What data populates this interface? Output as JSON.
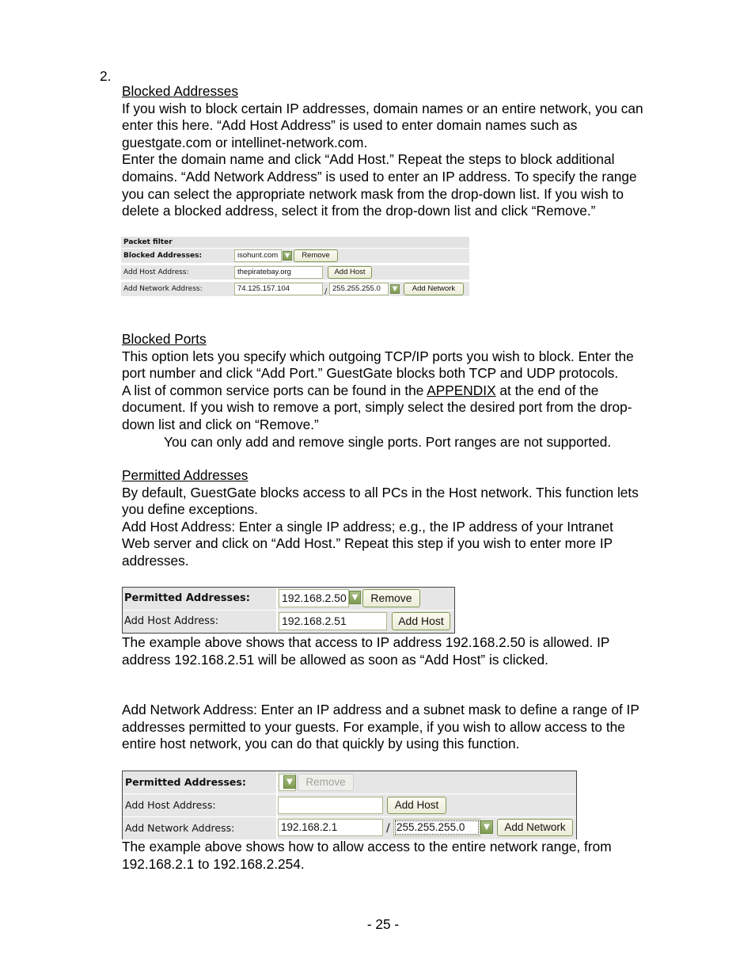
{
  "list_number": "2.",
  "sections": {
    "blocked_addresses": {
      "heading": "Blocked Addresses",
      "lines": [
        "If you wish to block certain IP addresses, domain names or an entire network, you can",
        "enter this here. “Add Host Address” is used to enter domain names such as",
        "guestgate.com or intellinet-network.com.",
        "Enter the domain name and click “Add Host.” Repeat the steps to block additional",
        "domains. “Add Network Address” is used to enter an IP address. To specify the range",
        "you can select the appropriate network mask from the drop-down list. If you wish to",
        "delete a blocked address, select it from the drop-down list and click “Remove.”"
      ]
    },
    "blocked_ports": {
      "heading": "Blocked Ports",
      "lines": [
        "This option lets you specify which outgoing TCP/IP ports you wish to block. Enter the",
        "port number and click “Add Port.” GuestGate blocks both TCP and UDP protocols."
      ],
      "appendix_prefix": "A list of common service ports can be found in the ",
      "appendix_link": "APPENDIX",
      "appendix_suffix": " at the end of the",
      "lines2": [
        "document. If you wish to remove a port, simply select the desired port from the drop-",
        "down list and click on “Remove.”"
      ],
      "note": "You can only add and remove single ports. Port ranges are not supported."
    },
    "permitted_addresses": {
      "heading": "Permitted Addresses",
      "lines": [
        "By default, GuestGate blocks access to all PCs in the Host network. This function lets",
        "you define exceptions.",
        "Add Host Address: Enter a single IP address; e.g., the IP address of your Intranet",
        "Web server and click on “Add Host.” Repeat this step if you wish to enter more IP",
        "addresses."
      ],
      "caption1": [
        "The example above shows that access to IP address 192.168.2.50 is allowed. IP",
        "address 192.168.2.51 will be allowed as soon as “Add Host” is clicked."
      ],
      "network_lines": [
        "Add Network Address: Enter an IP address and a subnet mask to define a range of IP",
        "addresses permitted to your guests. For example, if you wish to allow access to the",
        "entire host network, you can do that quickly by using this function."
      ],
      "caption2": [
        "The example above shows how to allow access to the entire network range, from",
        "192.168.2.1 to 192.168.2.254."
      ]
    }
  },
  "panel_packet_filter": {
    "title": "Packet filter",
    "blocked_label": "Blocked Addresses:",
    "blocked_selected": "isohunt.com",
    "remove_label": "Remove",
    "host_label": "Add Host Address:",
    "host_value": "thepiratebay.org",
    "add_host_label": "Add Host",
    "network_label": "Add Network Address:",
    "network_value": "74.125.157.104",
    "slash": "/",
    "mask_selected": "255.255.255.0",
    "add_network_label": "Add Network"
  },
  "panel_permitted_1": {
    "permitted_label": "Permitted Addresses:",
    "permitted_selected": "192.168.2.50",
    "remove_label": "Remove",
    "host_label": "Add Host Address:",
    "host_value": "192.168.2.51",
    "add_host_label": "Add Host"
  },
  "panel_permitted_2": {
    "permitted_label": "Permitted Addresses:",
    "permitted_selected": "",
    "remove_label": "Remove",
    "host_label": "Add Host Address:",
    "host_value": "",
    "add_host_label": "Add Host",
    "network_label": "Add Network Address:",
    "network_value": "192.168.2.1",
    "slash": "/",
    "mask_selected": "255.255.255.0",
    "add_network_label": "Add Network"
  },
  "icons": {
    "dropdown": "chevron-down-icon"
  },
  "colors": {
    "accent_green": "#7f9a52",
    "row_gray": "#e6e6e6"
  },
  "page_number": "- 25 -"
}
